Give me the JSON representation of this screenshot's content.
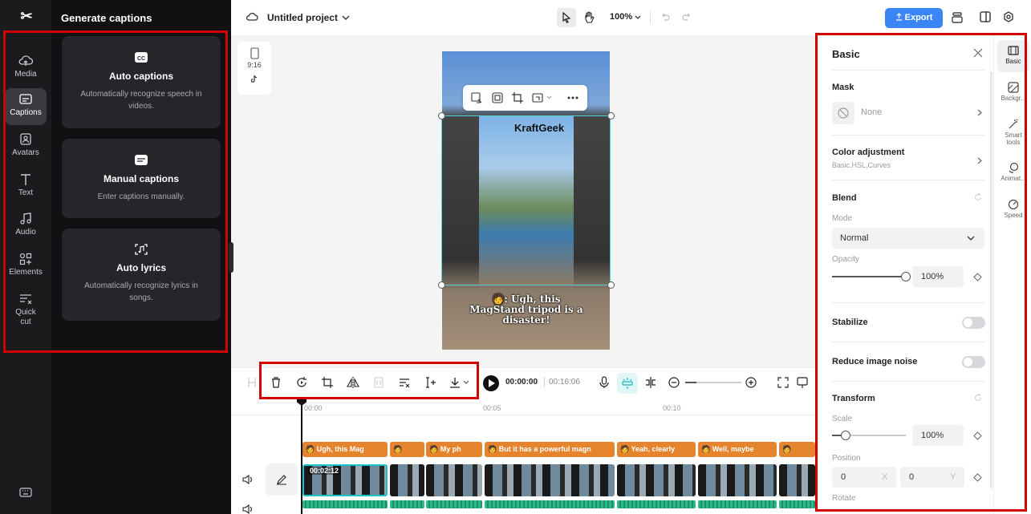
{
  "app": {
    "logo_glyph": "✂"
  },
  "rail": {
    "items": [
      {
        "label": "Media",
        "icon": "cloud-upload-icon"
      },
      {
        "label": "Captions",
        "icon": "captions-icon",
        "active": true
      },
      {
        "label": "Avatars",
        "icon": "avatar-icon"
      },
      {
        "label": "Text",
        "icon": "text-icon"
      },
      {
        "label": "Audio",
        "icon": "music-note-icon"
      },
      {
        "label": "Elements",
        "icon": "elements-icon"
      },
      {
        "label": "Quick",
        "label2": "cut",
        "icon": "quick-cut-icon"
      }
    ],
    "bottom_icon": "keyboard-icon"
  },
  "captions_panel": {
    "title": "Generate captions",
    "cards": [
      {
        "title": "Auto captions",
        "desc": "Automatically recognize speech in videos.",
        "icon": "cc-icon"
      },
      {
        "title": "Manual captions",
        "desc": "Enter captions manually.",
        "icon": "subtitle-icon"
      },
      {
        "title": "Auto lyrics",
        "desc": "Automatically recognize lyrics in songs.",
        "icon": "lyrics-icon"
      }
    ]
  },
  "topbar": {
    "project_name": "Untitled project",
    "zoom": "100%",
    "export_label": "Export"
  },
  "canvas": {
    "ratio": "9:16",
    "watermark": "KraftGeek",
    "caption": "🧑: Ugh, this MagStand tripod is a disaster!"
  },
  "timeline_toolbar": {
    "current_time": "00:00:00",
    "total_time": "00:16:06"
  },
  "timeline": {
    "ruler": [
      "00:00",
      "00:05",
      "00:10"
    ],
    "clip_time": "00:02:12",
    "caption_clips": [
      "🧑 Ugh, this Mag",
      "🧑",
      "🧑 My ph",
      "🧑 But it has a powerful magn",
      "🧑 Yeah, clearly",
      "🧑 Well, maybe",
      "🧑"
    ]
  },
  "inspector": {
    "title": "Basic",
    "mask": {
      "title": "Mask",
      "value": "None"
    },
    "color_adjustment": {
      "title": "Color adjustment",
      "subtitle": "Basic,HSL,Curves"
    },
    "blend": {
      "title": "Blend",
      "mode_label": "Mode",
      "mode_value": "Normal",
      "opacity_label": "Opacity",
      "opacity_value": "100%",
      "opacity_level": 1.0
    },
    "stabilize": {
      "title": "Stabilize",
      "enabled": false
    },
    "reduce_noise": {
      "title": "Reduce image noise",
      "enabled": false
    },
    "transform": {
      "title": "Transform",
      "scale_label": "Scale",
      "scale_value": "100%",
      "scale_level": 0.18,
      "position_label": "Position",
      "pos_x": "0",
      "pos_x_label": "X",
      "pos_y": "0",
      "pos_y_label": "Y",
      "rotate_label": "Rotate"
    }
  },
  "right_tabs": [
    {
      "label": "Basic",
      "icon": "basic-icon",
      "active": true
    },
    {
      "label": "Backgr...",
      "icon": "background-icon"
    },
    {
      "label": "Smart",
      "label2": "tools",
      "icon": "magic-wand-icon"
    },
    {
      "label": "Animat...",
      "icon": "animation-icon"
    },
    {
      "label": "Speed",
      "icon": "speed-icon"
    }
  ]
}
